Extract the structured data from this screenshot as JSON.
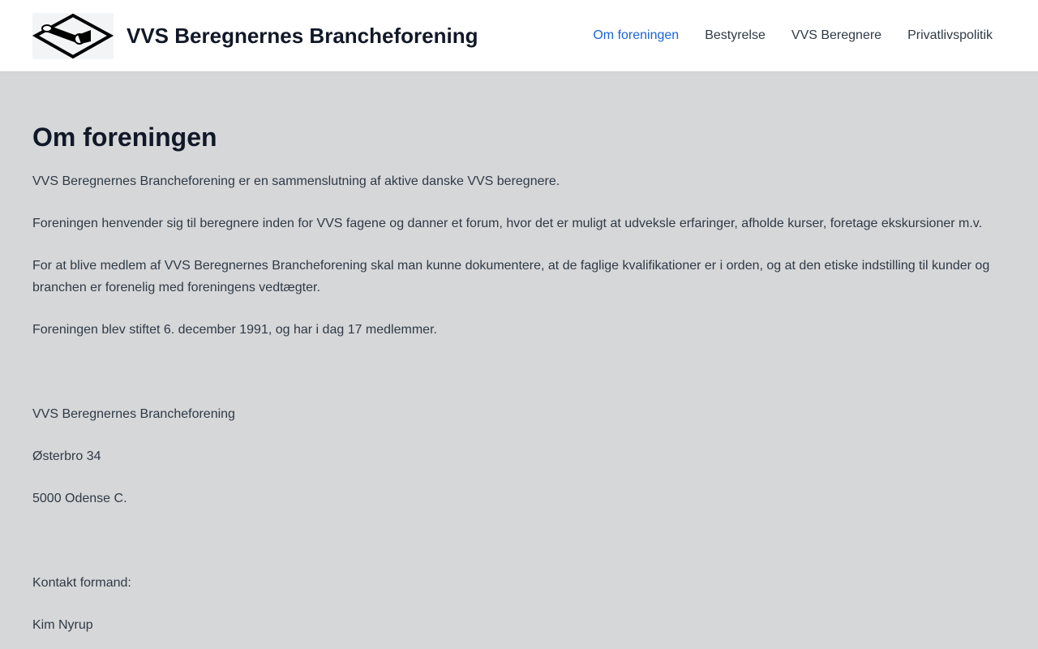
{
  "header": {
    "site_title": "VVS Beregnernes Brancheforening",
    "logo_icon": "sprinkler-logo-icon",
    "nav": [
      {
        "label": "Om foreningen",
        "active": true
      },
      {
        "label": "Bestyrelse",
        "active": false
      },
      {
        "label": "VVS Beregnere",
        "active": false
      },
      {
        "label": "Privatlivspolitik",
        "active": false
      }
    ]
  },
  "main": {
    "title": "Om foreningen",
    "paragraphs": [
      "VVS Beregnernes Brancheforening er en sammenslutning af aktive danske VVS beregnere.",
      "Foreningen henvender sig til beregnere inden for VVS fagene og danner et forum, hvor det er muligt at udveksle erfaringer, afholde kurser, foretage ekskursioner m.v.",
      "For at blive medlem af VVS Beregnernes Brancheforening skal man kunne dokumentere, at de faglige kvalifikationer er i orden, og at den etiske indstilling til kunder og branchen er forenelig med foreningens vedtægter.",
      "Foreningen blev stiftet 6. december 1991, og har i dag 17 medlemmer."
    ],
    "address": {
      "name": "VVS Beregnernes Brancheforening",
      "street": "Østerbro 34",
      "city": "5000 Odense C."
    },
    "contact": {
      "label": "Kontakt formand:",
      "name": "Kim Nyrup"
    }
  },
  "colors": {
    "page_background": "#d6d7d9",
    "header_background": "#ffffff",
    "link_active": "#1c64d4",
    "heading": "#111827",
    "body_text": "#2f3a45"
  }
}
